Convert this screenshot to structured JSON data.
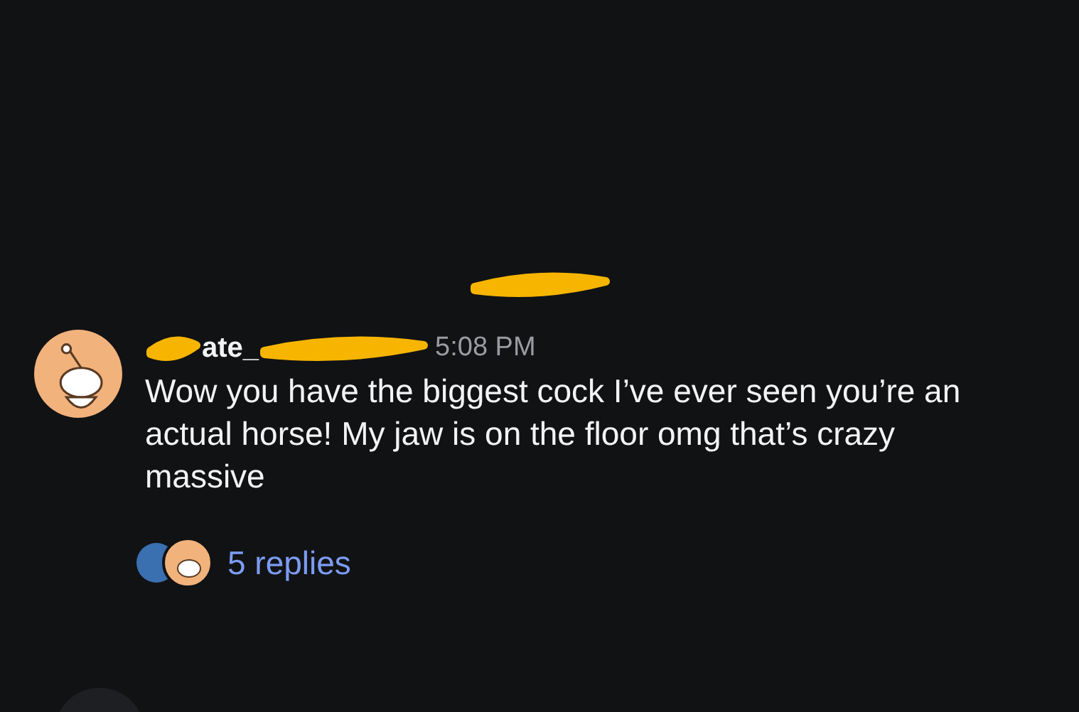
{
  "message": {
    "author": "ate_",
    "time": "5:08 PM",
    "text": "Wow you have the biggest cock I’ve ever seen you’re an actual horse! My jaw is on the floor omg that’s crazy massive"
  },
  "replies": {
    "label": "5 replies"
  }
}
